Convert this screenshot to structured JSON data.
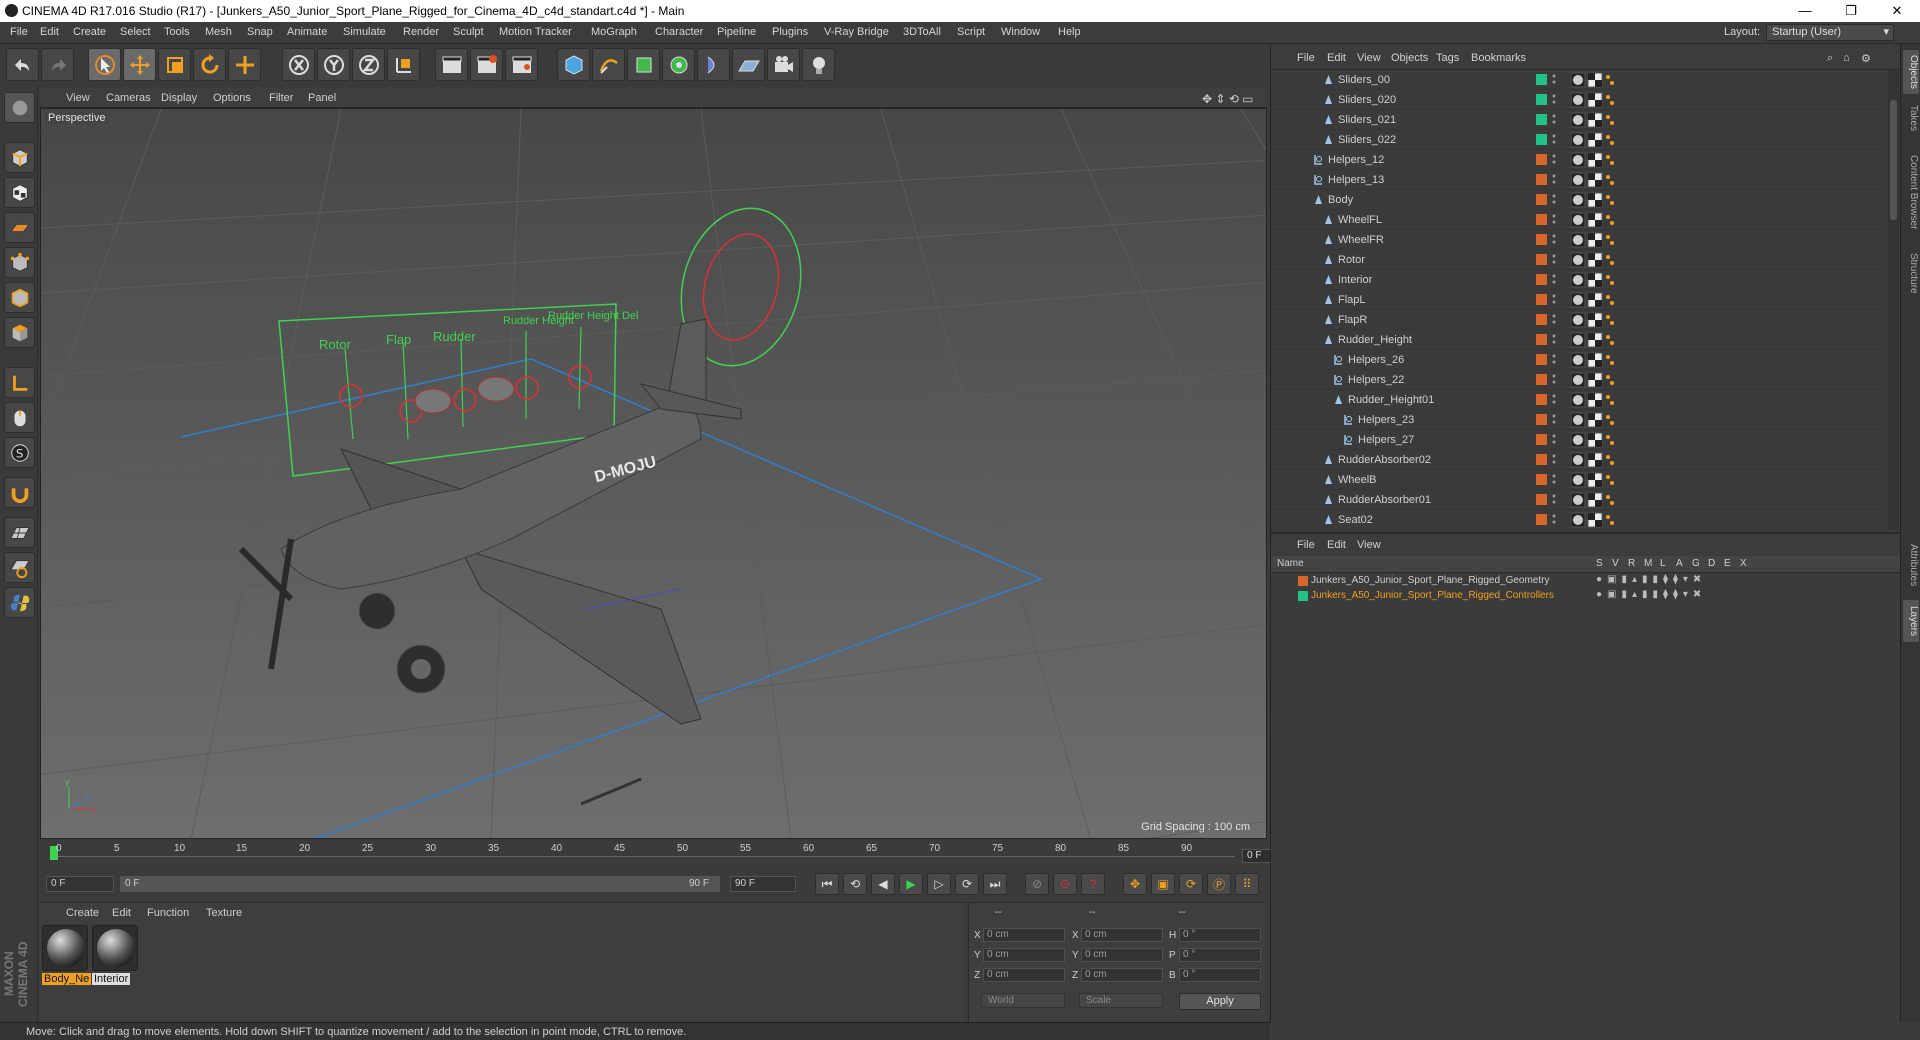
{
  "window": {
    "title": "CINEMA 4D R17.016 Studio (R17) - [Junkers_A50_Junior_Sport_Plane_Rigged_for_Cinema_4D_c4d_standart.c4d *] - Main",
    "minimize": "—",
    "maximize": "❐",
    "close": "✕"
  },
  "menubar": {
    "items": [
      "File",
      "Edit",
      "Create",
      "Select",
      "Tools",
      "Mesh",
      "Snap",
      "Animate",
      "Simulate",
      "Render",
      "Sculpt",
      "Motion Tracker",
      "MoGraph",
      "Character",
      "Pipeline",
      "Plugins",
      "V-Ray Bridge",
      "3DToAll",
      "Script",
      "Window",
      "Help"
    ],
    "layout_label": "Layout:",
    "layout_value": "Startup (User)"
  },
  "viewport": {
    "menu": [
      "View",
      "Cameras",
      "Display",
      "Options",
      "Filter",
      "Panel"
    ],
    "label": "Perspective",
    "grid_spacing": "Grid Spacing : 100 cm",
    "controller_labels": [
      "Rotor",
      "Flap",
      "Rudder",
      "Rudder Height",
      "Rudder Height Del"
    ],
    "plane_registration": "D-MOJU",
    "axis": {
      "x": "x",
      "y": "y",
      "z": "z"
    }
  },
  "timeline": {
    "ticks": [
      "0",
      "5",
      "10",
      "15",
      "20",
      "25",
      "30",
      "35",
      "40",
      "45",
      "50",
      "55",
      "60",
      "65",
      "70",
      "75",
      "80",
      "85",
      "90"
    ],
    "frame_end": "0 F",
    "current_frame": "0 F",
    "range_start": "0 F",
    "range_end": "90 F",
    "max_frame": "90 F"
  },
  "materials": {
    "menu": [
      "Create",
      "Edit",
      "Function",
      "Texture"
    ],
    "items": [
      {
        "label": "Body_Ne",
        "highlight": "#f0a020"
      },
      {
        "label": "Interior",
        "highlight": "#dddddd"
      }
    ],
    "brand_top": "MAXON",
    "brand_bottom": "CINEMA 4D"
  },
  "coords": {
    "header": [
      "--",
      "--",
      "--"
    ],
    "rows": [
      {
        "a": "X",
        "av": "0 cm",
        "b": "X",
        "bv": "0 cm",
        "c": "H",
        "cv": "0 °"
      },
      {
        "a": "Y",
        "av": "0 cm",
        "b": "Y",
        "bv": "0 cm",
        "c": "P",
        "cv": "0 °"
      },
      {
        "a": "Z",
        "av": "0 cm",
        "b": "Z",
        "bv": "0 cm",
        "c": "B",
        "cv": "0 °"
      }
    ],
    "world": "World",
    "scale": "Scale",
    "apply": "Apply"
  },
  "status": "Move: Click and drag to move elements. Hold down SHIFT to quantize movement / add to the selection in point mode, CTRL to remove.",
  "objects": {
    "menu": [
      "File",
      "Edit",
      "View",
      "Objects",
      "Tags",
      "Bookmarks"
    ],
    "rows": [
      {
        "name": "Sliders_00",
        "indent": 2,
        "type": "bone",
        "layer": "#23c285"
      },
      {
        "name": "Sliders_020",
        "indent": 2,
        "type": "bone",
        "layer": "#23c285"
      },
      {
        "name": "Sliders_021",
        "indent": 2,
        "type": "bone",
        "layer": "#23c285"
      },
      {
        "name": "Sliders_022",
        "indent": 2,
        "type": "bone",
        "layer": "#23c285"
      },
      {
        "name": "Helpers_12",
        "indent": 1,
        "type": "null",
        "layer": "#d8662a"
      },
      {
        "name": "Helpers_13",
        "indent": 1,
        "type": "null",
        "layer": "#d8662a"
      },
      {
        "name": "Body",
        "indent": 1,
        "type": "bone",
        "layer": "#d8662a"
      },
      {
        "name": "WheelFL",
        "indent": 2,
        "type": "bone",
        "layer": "#d8662a"
      },
      {
        "name": "WheelFR",
        "indent": 2,
        "type": "bone",
        "layer": "#d8662a"
      },
      {
        "name": "Rotor",
        "indent": 2,
        "type": "bone",
        "layer": "#d8662a"
      },
      {
        "name": "Interior",
        "indent": 2,
        "type": "bone",
        "layer": "#d8662a"
      },
      {
        "name": "FlapL",
        "indent": 2,
        "type": "bone",
        "layer": "#d8662a"
      },
      {
        "name": "FlapR",
        "indent": 2,
        "type": "bone",
        "layer": "#d8662a"
      },
      {
        "name": "Rudder_Height",
        "indent": 2,
        "type": "bone",
        "layer": "#d8662a"
      },
      {
        "name": "Helpers_26",
        "indent": 3,
        "type": "null",
        "layer": "#d8662a"
      },
      {
        "name": "Helpers_22",
        "indent": 3,
        "type": "null",
        "layer": "#d8662a"
      },
      {
        "name": "Rudder_Height01",
        "indent": 3,
        "type": "bone",
        "layer": "#d8662a"
      },
      {
        "name": "Helpers_23",
        "indent": 4,
        "type": "null",
        "layer": "#d8662a"
      },
      {
        "name": "Helpers_27",
        "indent": 4,
        "type": "null",
        "layer": "#d8662a"
      },
      {
        "name": "RudderAbsorber02",
        "indent": 2,
        "type": "bone",
        "layer": "#d8662a"
      },
      {
        "name": "WheelB",
        "indent": 2,
        "type": "bone",
        "layer": "#d8662a"
      },
      {
        "name": "RudderAbsorber01",
        "indent": 2,
        "type": "bone",
        "layer": "#d8662a"
      },
      {
        "name": "Seat02",
        "indent": 2,
        "type": "bone",
        "layer": "#d8662a"
      }
    ]
  },
  "layers": {
    "menu": [
      "File",
      "Edit",
      "View"
    ],
    "header_name": "Name",
    "header_cols": [
      "S",
      "V",
      "R",
      "M",
      "L",
      "A",
      "G",
      "D",
      "E",
      "X"
    ],
    "rows": [
      {
        "name": "Junkers_A50_Junior_Sport_Plane_Rigged_Geometry",
        "color": "#d8662a",
        "text_color": "#d0d0d0"
      },
      {
        "name": "Junkers_A50_Junior_Sport_Plane_Rigged_Controllers",
        "color": "#23c285",
        "text_color": "#f0a020"
      }
    ]
  },
  "sidetabs": [
    "Objects",
    "Takes",
    "Content Browser",
    "Structure",
    "Attributes",
    "Layers"
  ]
}
